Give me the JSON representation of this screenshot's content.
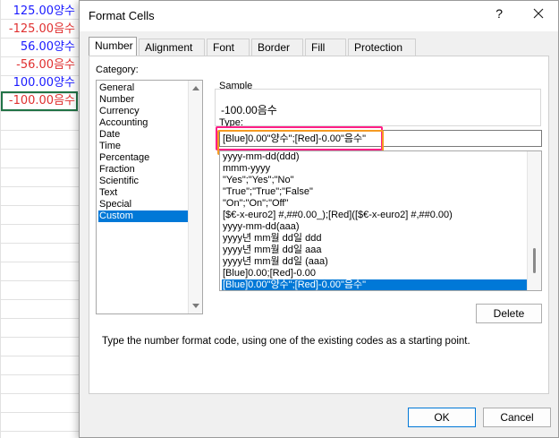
{
  "sheet": {
    "cells": [
      {
        "text": "125.00양수",
        "color": "#1a1aff"
      },
      {
        "text": "-125.00음수",
        "color": "#e03030"
      },
      {
        "text": "56.00양수",
        "color": "#1a1aff"
      },
      {
        "text": "-56.00음수",
        "color": "#e03030"
      },
      {
        "text": "100.00양수",
        "color": "#1a1aff"
      },
      {
        "text": "-100.00음수",
        "color": "#e03030"
      }
    ]
  },
  "dialog": {
    "title": "Format Cells",
    "help_label": "?",
    "tabs": [
      "Number",
      "Alignment",
      "Font",
      "Border",
      "Fill",
      "Protection"
    ],
    "selected_tab": "Number",
    "category_label": "Category:",
    "categories": [
      "General",
      "Number",
      "Currency",
      "Accounting",
      "Date",
      "Time",
      "Percentage",
      "Fraction",
      "Scientific",
      "Text",
      "Special",
      "Custom"
    ],
    "selected_category": "Custom",
    "sample_label": "Sample",
    "sample_value": "-100.00음수",
    "type_label": "Type:",
    "type_value": "[Blue]0.00\"양수\";[Red]-0.00\"음수\"",
    "formats": [
      "yyyy-mm-dd(ddd)",
      "mmm-yyyy",
      "\"Yes\";\"Yes\";\"No\"",
      "\"True\";\"True\";\"False\"",
      "\"On\";\"On\";\"Off\"",
      "[$€-x-euro2] #,##0.00_);[Red]([$€-x-euro2] #,##0.00)",
      "yyyy-mm-dd(aaa)",
      "yyyy년 mm월 dd일 ddd",
      "yyyy년 mm월 dd일 aaa",
      "yyyy년 mm월 dd일 (aaa)",
      "[Blue]0.00;[Red]-0.00",
      "[Blue]0.00\"양수\";[Red]-0.00\"음수\""
    ],
    "selected_format_index": 11,
    "delete_label": "Delete",
    "description": "Type the number format code, using one of the existing codes as a starting point.",
    "ok_label": "OK",
    "cancel_label": "Cancel",
    "accent_color": "#0078d7",
    "highlight_colors": [
      "#ff1f86",
      "#f59a23"
    ]
  }
}
